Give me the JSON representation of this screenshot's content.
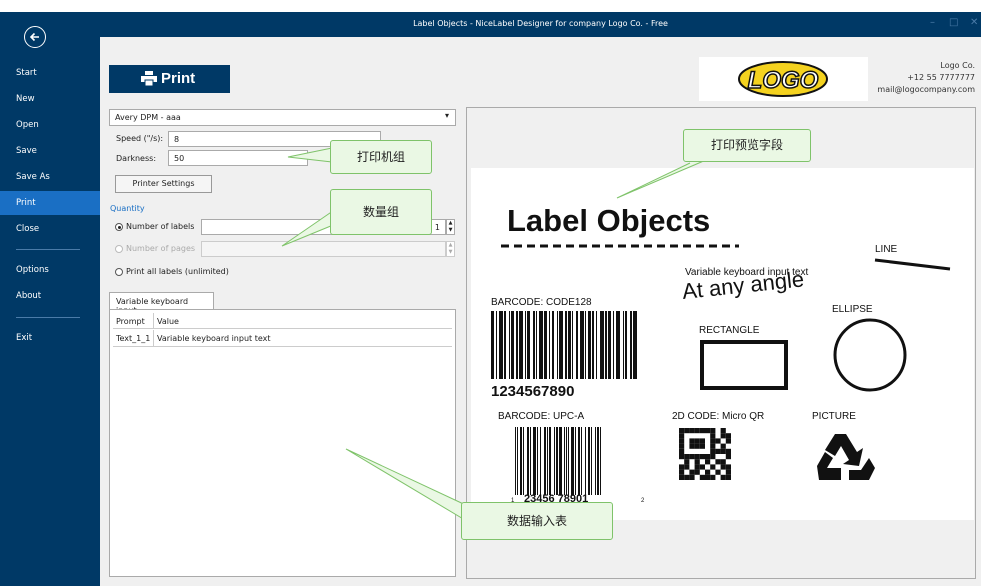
{
  "window": {
    "title": "Label Objects - NiceLabel Designer for company Logo Co. - Free"
  },
  "sidebar": {
    "items": [
      {
        "label": "Start"
      },
      {
        "label": "New"
      },
      {
        "label": "Open"
      },
      {
        "label": "Save"
      },
      {
        "label": "Save As"
      },
      {
        "label": "Print"
      },
      {
        "label": "Close"
      },
      {
        "label": "Options"
      },
      {
        "label": "About"
      },
      {
        "label": "Exit"
      }
    ],
    "active": "Print"
  },
  "header": {
    "print_label": "Print",
    "logo_text": "LOGO",
    "company": {
      "name": "Logo Co.",
      "phone": "+12 55 7777777",
      "email": "mail@logocompany.com"
    }
  },
  "printer": {
    "selected": "Avery DPM - aaa",
    "speed_label": "Speed (\"/s):",
    "speed_value": "8",
    "darkness_label": "Darkness:",
    "darkness_value": "50",
    "settings_button": "Printer Settings"
  },
  "quantity": {
    "title": "Quantity",
    "number_of_labels": "Number of labels",
    "number_of_labels_value": "1",
    "number_of_pages": "Number of pages",
    "print_all": "Print all labels (unlimited)"
  },
  "data_table": {
    "tab": "Variable keyboard input",
    "columns": [
      "Prompt",
      "Value"
    ],
    "rows": [
      {
        "prompt": "Text_1_1",
        "value": "Variable keyboard input text"
      }
    ]
  },
  "label_preview": {
    "title": "Label Objects",
    "line": "LINE",
    "variable_text": "Variable keyboard input text",
    "angle_text": "At any angle",
    "barcode128_label": "BARCODE: CODE128",
    "barcode128_digits": "1234567890",
    "rectangle": "RECTANGLE",
    "ellipse": "ELLIPSE",
    "upca_label": "BARCODE: UPC-A",
    "upca_left": "1",
    "upca_digits": "23456 78901",
    "upca_right": "2",
    "qr_label": "2D CODE: Micro QR",
    "picture": "PICTURE"
  },
  "callouts": {
    "printer_group": "打印机组",
    "quantity_group": "数量组",
    "preview_field": "打印预览字段",
    "data_table": "数据输入表"
  },
  "colors": {
    "sidebar": "#003966",
    "active": "#1a6fc4",
    "callout_bg": "#eaf8e4",
    "callout_border": "#7fc36a"
  }
}
